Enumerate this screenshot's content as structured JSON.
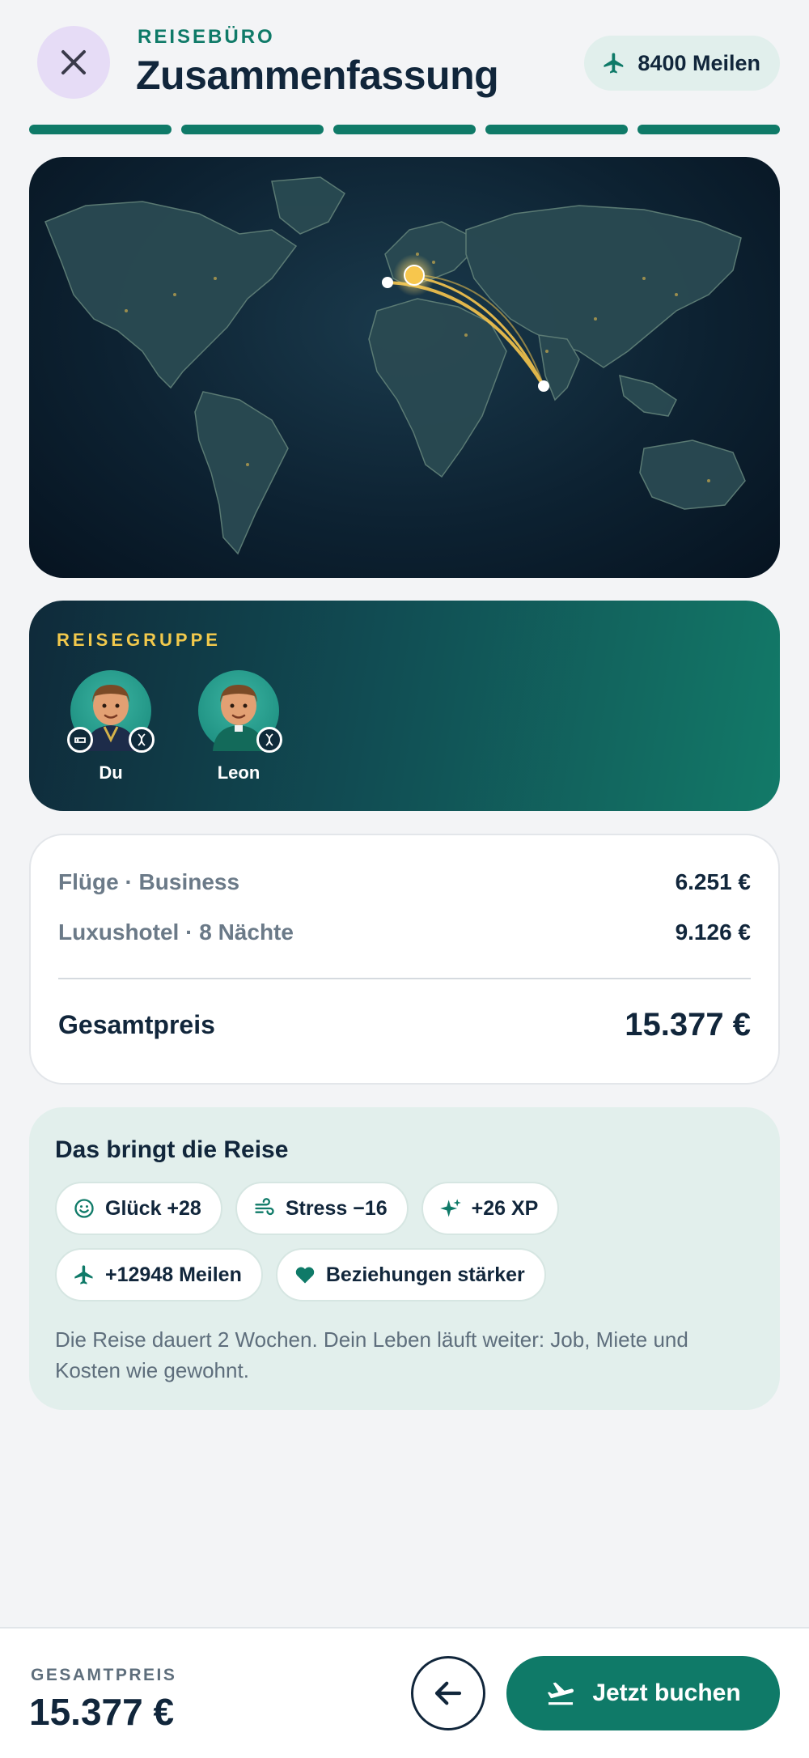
{
  "header": {
    "eyebrow": "REISEBÜRO",
    "title": "Zusammenfassung",
    "miles": "8400 Meilen",
    "close_icon": "close-icon",
    "plane_icon": "airplane-icon"
  },
  "progress": {
    "steps_total": 5,
    "steps_completed": 5,
    "color": "#0f7a68"
  },
  "route_map": {
    "origin": "Europe",
    "destination": "South Asia",
    "route_color": "#f7c64d"
  },
  "group": {
    "label": "REISEGRUPPE",
    "members": [
      {
        "name": "Du"
      },
      {
        "name": "Leon"
      }
    ]
  },
  "costs": {
    "items": [
      {
        "label": "Flüge · Business",
        "value": "6.251 €"
      },
      {
        "label": "Luxushotel · 8 Nächte",
        "value": "9.126 €"
      }
    ],
    "total_label": "Gesamtpreis",
    "total_value": "15.377 €"
  },
  "benefits": {
    "title": "Das bringt die Reise",
    "chips": [
      {
        "label": "Glück +28",
        "icon": "smiley-icon"
      },
      {
        "label": "Stress −16",
        "icon": "wind-icon"
      },
      {
        "label": "+26 XP",
        "icon": "sparkle-icon"
      },
      {
        "label": "+12948 Meilen",
        "icon": "airplane-icon"
      },
      {
        "label": "Beziehungen stärker",
        "icon": "heart-icon"
      }
    ],
    "note": "Die Reise dauert 2 Wochen. Dein Leben läuft weiter: Job, Miete und Kosten wie gewohnt."
  },
  "footer": {
    "label": "GESAMTPREIS",
    "total": "15.377 €",
    "back_icon": "arrow-left-icon",
    "book_label": "Jetzt buchen",
    "book_icon": "departure-icon"
  },
  "colors": {
    "accent": "#0f7a68",
    "gold": "#f2c94c",
    "text": "#11263b"
  }
}
